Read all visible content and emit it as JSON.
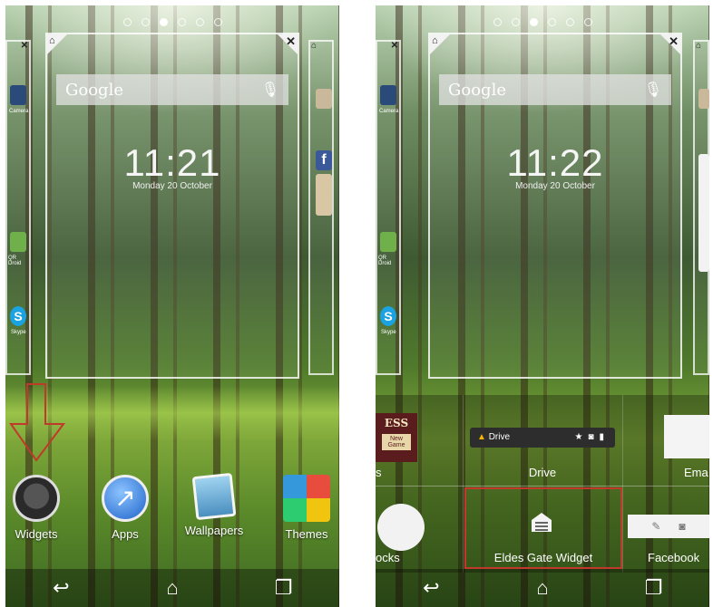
{
  "left_screen": {
    "clock": "11:21",
    "date": "Monday 20 October",
    "search_label": "Google",
    "left_apps": [
      "Camera",
      "QR Droid",
      "Skype"
    ],
    "dock": [
      {
        "label": "Widgets"
      },
      {
        "label": "Apps"
      },
      {
        "label": "Wallpapers"
      },
      {
        "label": "Themes"
      }
    ]
  },
  "right_screen": {
    "clock": "11:22",
    "date": "Monday 20 October",
    "search_label": "Google",
    "left_apps": [
      "Camera",
      "QR Droid",
      "Skype"
    ],
    "widgets_row1": {
      "partial_left": "s",
      "drive_label": "Drive",
      "drive_chip": "Drive",
      "partial_right": "Ema"
    },
    "widgets_row2": {
      "partial_left": "ocks",
      "eldes": "Eldes Gate Widget",
      "facebook": "Facebook"
    },
    "chess_text": "ESS",
    "chess_sub": "New Game"
  },
  "colors": {
    "highlight": "#c0392b",
    "drive_chip_bg": "#2d2d2d"
  }
}
